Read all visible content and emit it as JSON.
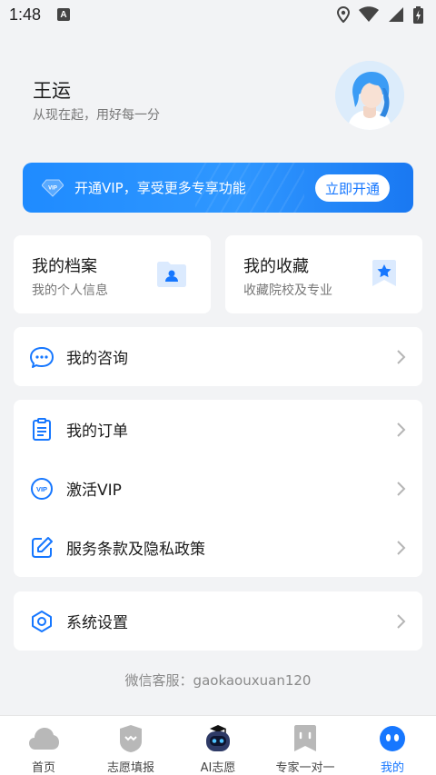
{
  "status_bar": {
    "time": "1:48",
    "a_badge": "A"
  },
  "profile": {
    "name": "王运",
    "motto": "从现在起，用好每一分"
  },
  "vip_banner": {
    "badge": "VIP",
    "text": "开通VIP，享受更多专享功能",
    "button": "立即开通"
  },
  "cards": [
    {
      "title": "我的档案",
      "subtitle": "我的个人信息",
      "icon": "profile-folder-icon"
    },
    {
      "title": "我的收藏",
      "subtitle": "收藏院校及专业",
      "icon": "star-bookmark-icon"
    }
  ],
  "menu": {
    "consult": "我的咨询",
    "orders": "我的订单",
    "activate_vip": "激活VIP",
    "vip_icon_text": "VIP",
    "terms": "服务条款及隐私政策",
    "settings": "系统设置"
  },
  "service": "微信客服：gaokaouxuan120",
  "tabs": [
    {
      "label": "首页",
      "icon": "cloud-home-icon"
    },
    {
      "label": "志愿填报",
      "icon": "badge-icon"
    },
    {
      "label": "AI志愿",
      "icon": "robot-icon"
    },
    {
      "label": "专家一对一",
      "icon": "bookmark-icon"
    },
    {
      "label": "我的",
      "icon": "me-icon"
    }
  ],
  "colors": {
    "accent": "#1677ff",
    "background": "#f2f3f5"
  }
}
